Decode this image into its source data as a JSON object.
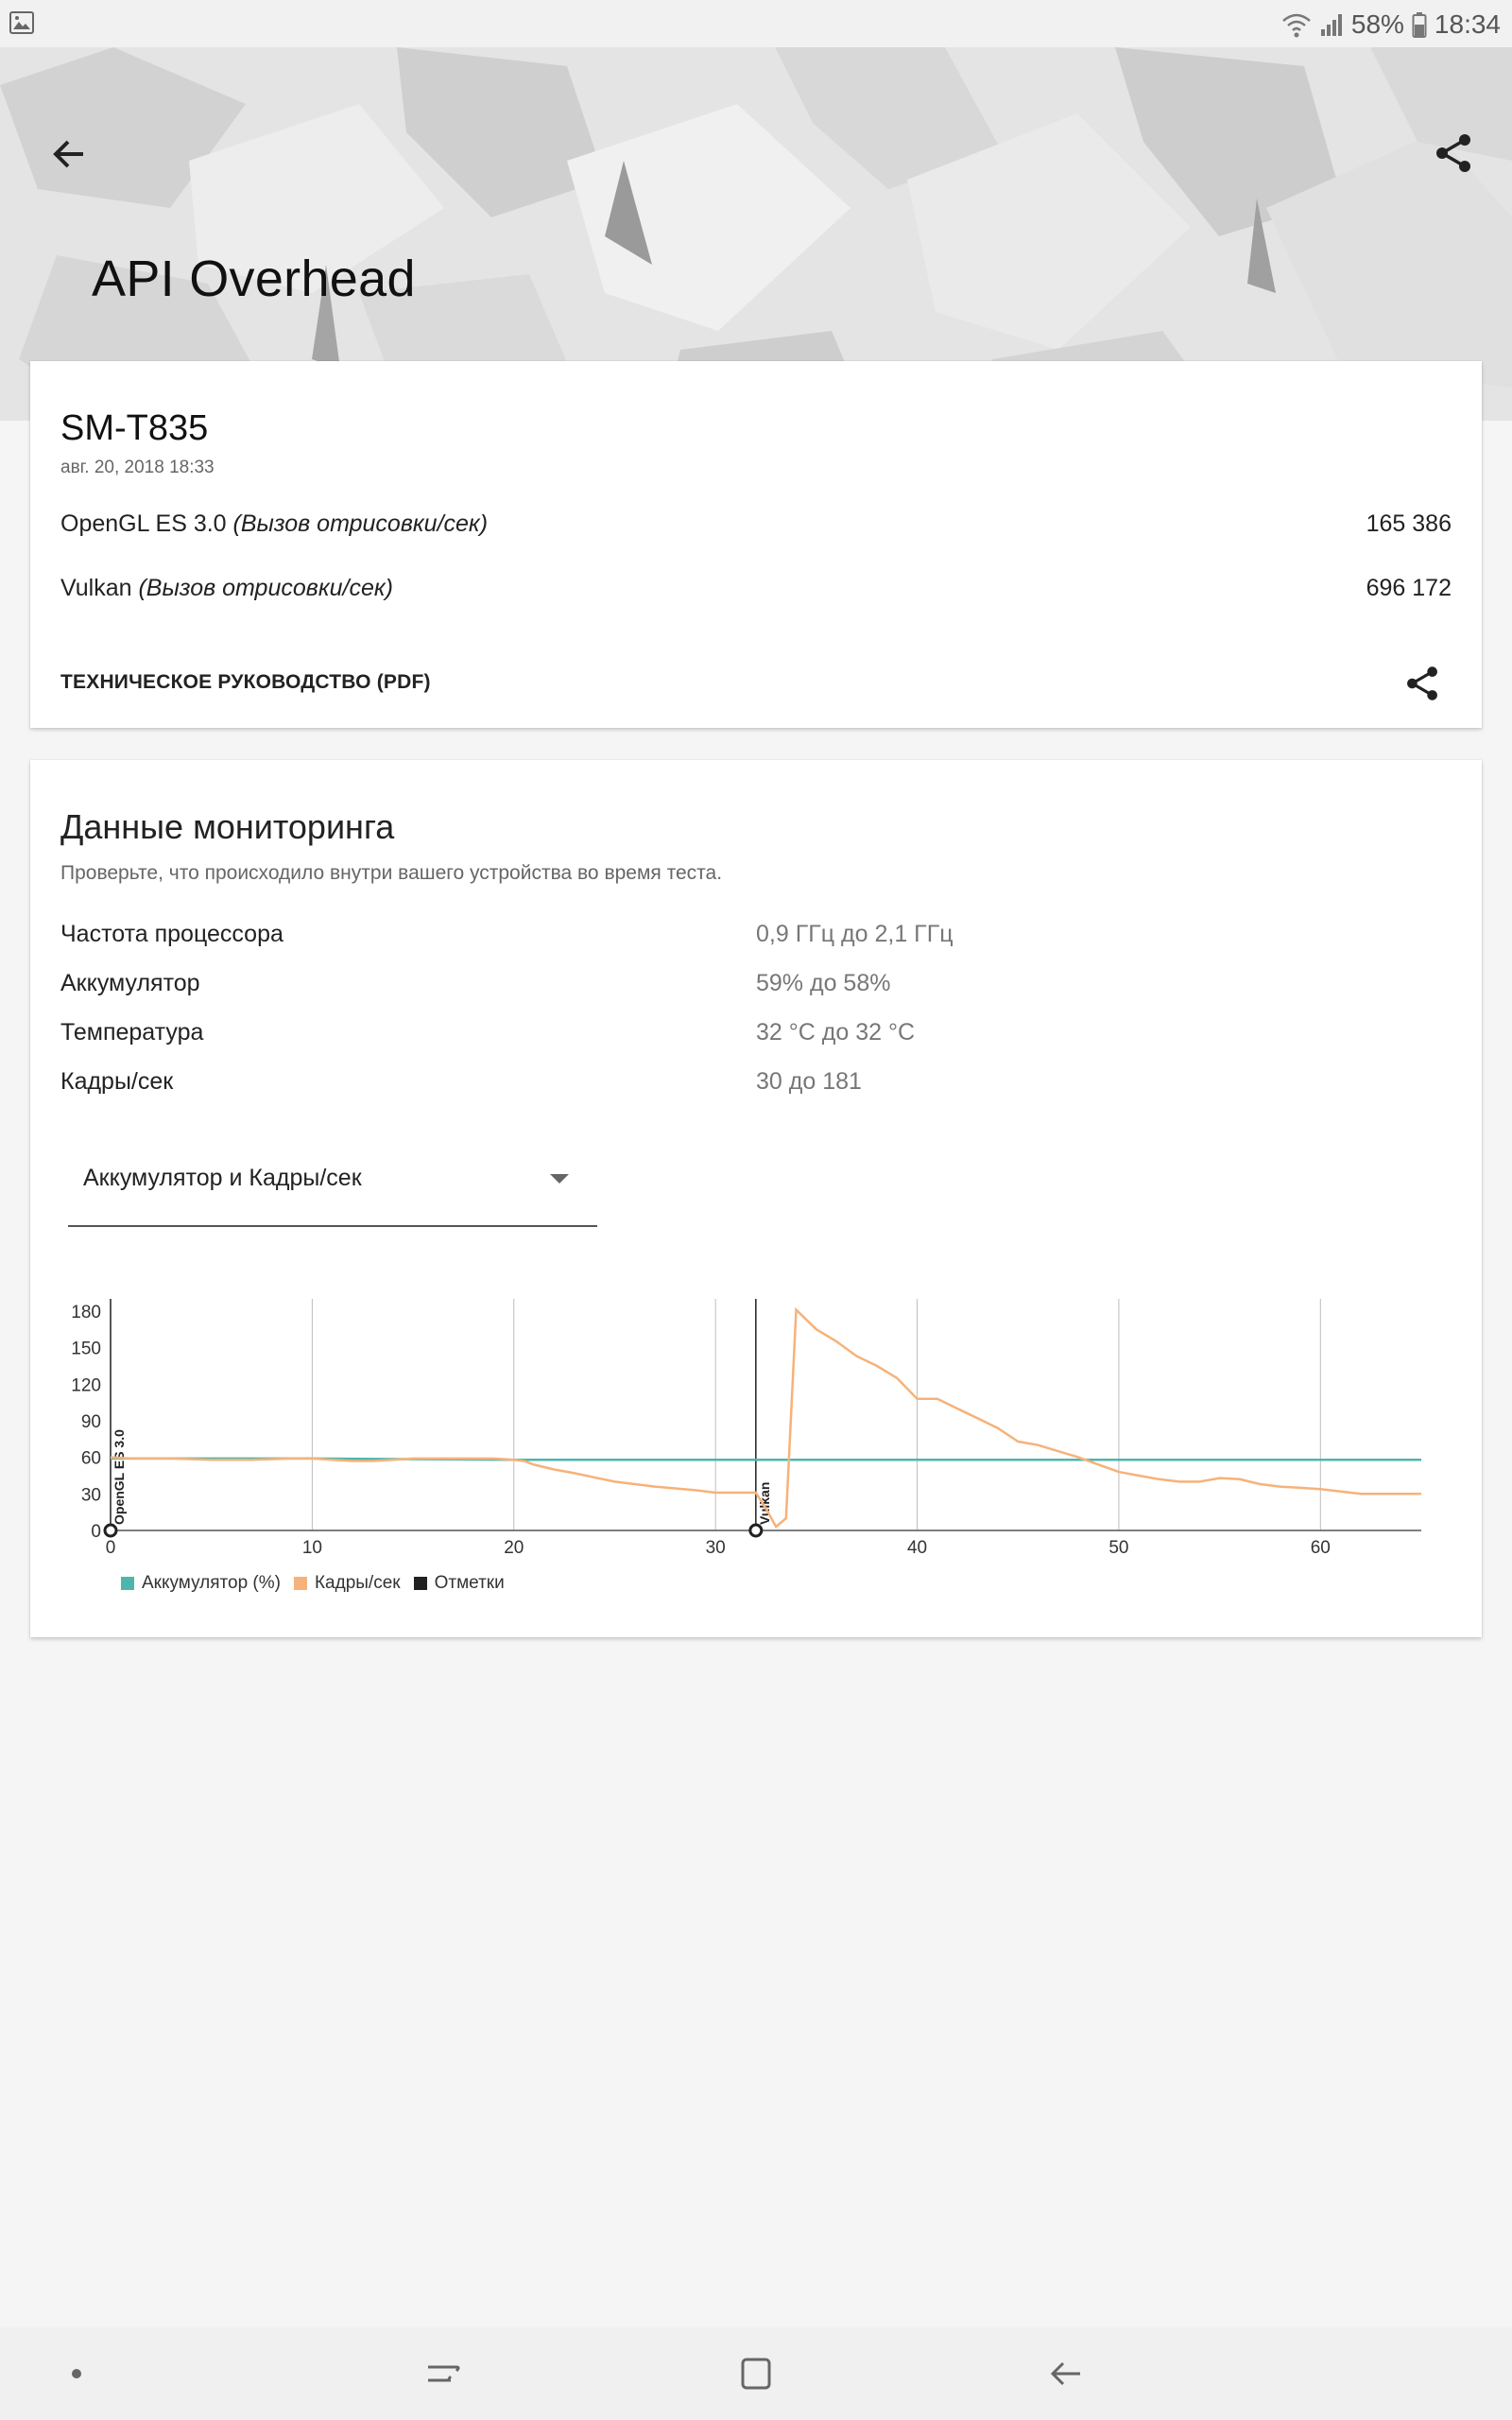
{
  "status_bar": {
    "battery": "58%",
    "time": "18:34",
    "icons": [
      "gallery-icon",
      "wifi-icon",
      "signal-icon",
      "battery-icon"
    ]
  },
  "header": {
    "title": "API Overhead",
    "back_icon": "arrow-left-icon",
    "share_icon": "share-icon"
  },
  "result_card": {
    "device": "SM-T835",
    "date": "авг. 20, 2018 18:33",
    "scores": [
      {
        "name": "OpenGL ES 3.0 ",
        "unit": "(Вызов отрисовки/сек)",
        "value": "165 386"
      },
      {
        "name": "Vulkan ",
        "unit": "(Вызов отрисовки/сек)",
        "value": "696 172"
      }
    ],
    "guide_link": "ТЕХНИЧЕСКОЕ РУКОВОДСТВО (PDF)"
  },
  "monitoring": {
    "title": "Данные мониторинга",
    "subtitle": "Проверьте, что происходило внутри вашего устройства во время теста.",
    "rows": [
      {
        "label": "Частота процессора",
        "value": "0,9 ГГц до 2,1 ГГц"
      },
      {
        "label": "Аккумулятор",
        "value": "59% до 58%"
      },
      {
        "label": "Температура",
        "value": "32 °C до 32 °C"
      },
      {
        "label": "Кадры/сек",
        "value": "30 до 181"
      }
    ],
    "dropdown": {
      "selected": "Аккумулятор и Кадры/сек"
    }
  },
  "chart_data": {
    "type": "line",
    "title": "",
    "xlabel": "",
    "ylabel": "",
    "xlim": [
      0,
      65
    ],
    "ylim": [
      0,
      190
    ],
    "x_ticks": [
      0,
      10,
      20,
      30,
      40,
      50,
      60
    ],
    "y_ticks": [
      0,
      30,
      60,
      90,
      120,
      150,
      180
    ],
    "grid": "vertical",
    "legend_position": "bottom-left",
    "series": [
      {
        "name": "Аккумулятор (%)",
        "color": "#4db6ac",
        "x": [
          0,
          10,
          20,
          30,
          40,
          50,
          65
        ],
        "values": [
          59,
          59,
          58,
          58,
          58,
          58,
          58
        ]
      },
      {
        "name": "Кадры/сек",
        "color": "#f6b27a",
        "x": [
          0,
          1,
          3,
          5,
          7,
          9,
          10,
          11,
          12,
          13,
          14,
          15,
          17,
          19,
          20,
          20.5,
          21,
          22,
          23,
          25,
          27,
          29,
          30,
          31,
          32,
          32.5,
          33,
          33.5,
          34,
          35,
          36,
          37,
          38,
          39,
          40,
          41,
          42,
          43,
          44,
          45,
          46,
          47,
          48,
          49,
          50,
          51,
          52,
          53,
          54,
          55,
          56,
          57,
          58,
          59,
          60,
          61,
          62,
          63,
          64,
          65
        ],
        "values": [
          60,
          59,
          59,
          58,
          58,
          59,
          59,
          58,
          57,
          57,
          58,
          59,
          59,
          59,
          58,
          57,
          54,
          50,
          47,
          40,
          36,
          33,
          31,
          31,
          31,
          18,
          3,
          10,
          181,
          165,
          155,
          143,
          135,
          125,
          108,
          108,
          100,
          92,
          84,
          73,
          70,
          65,
          60,
          54,
          48,
          45,
          42,
          40,
          40,
          43,
          42,
          38,
          36,
          35,
          34,
          32,
          30,
          30,
          30,
          30
        ]
      }
    ],
    "markers": [
      {
        "x": 0,
        "label": "OpenGL ES 3.0"
      },
      {
        "x": 32,
        "label": "Vulkan"
      }
    ],
    "legend": [
      {
        "name": "Аккумулятор (%)",
        "color": "#4db6ac"
      },
      {
        "name": "Кадры/сек",
        "color": "#f6b27a"
      },
      {
        "name": "Отметки",
        "color": "#212121"
      }
    ]
  },
  "nav_bar": {
    "icons": [
      "dot-icon",
      "recents-icon",
      "home-icon",
      "back-icon"
    ]
  }
}
